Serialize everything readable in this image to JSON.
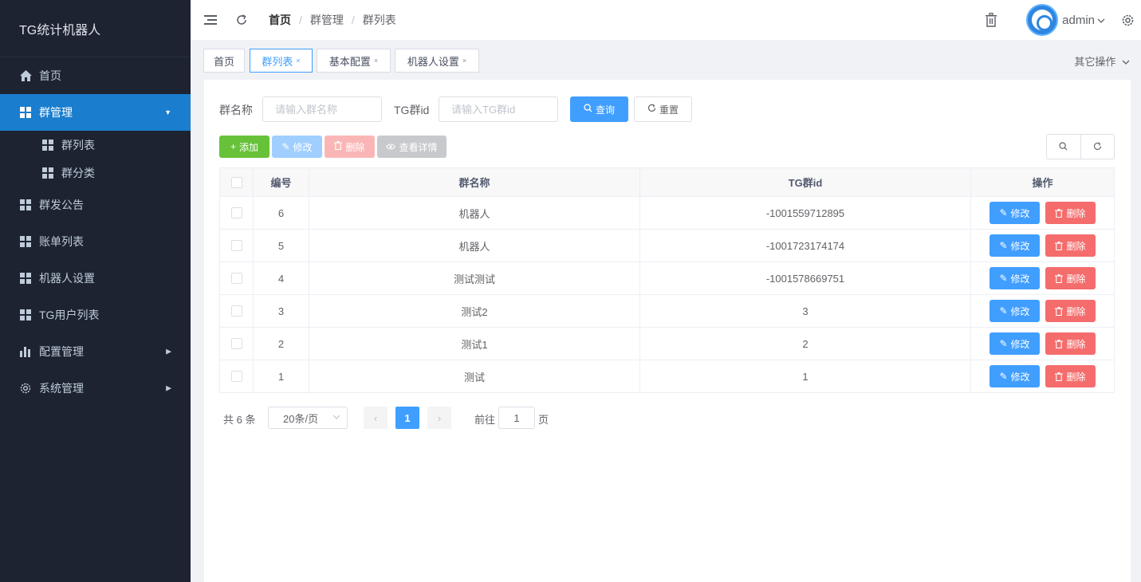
{
  "app": {
    "title": "TG统计机器人"
  },
  "sidebar": {
    "items": [
      {
        "label": "首页",
        "icon": "home-icon"
      },
      {
        "label": "群管理",
        "icon": "grid-icon",
        "active": true,
        "children": [
          {
            "label": "群列表"
          },
          {
            "label": "群分类"
          }
        ]
      },
      {
        "label": "群发公告",
        "icon": "grid-icon"
      },
      {
        "label": "账单列表",
        "icon": "grid-icon"
      },
      {
        "label": "机器人设置",
        "icon": "grid-icon"
      },
      {
        "label": "TG用户列表",
        "icon": "grid-icon"
      },
      {
        "label": "配置管理",
        "icon": "chart-icon"
      },
      {
        "label": "系统管理",
        "icon": "gear-icon"
      }
    ]
  },
  "header": {
    "breadcrumb": [
      "首页",
      "群管理",
      "群列表"
    ],
    "username": "admin"
  },
  "tabs": [
    {
      "label": "首页",
      "closable": false
    },
    {
      "label": "群列表",
      "closable": true,
      "active": true
    },
    {
      "label": "基本配置",
      "closable": true
    },
    {
      "label": "机器人设置",
      "closable": true
    }
  ],
  "tab_close": "×",
  "other_ops": "其它操作",
  "search": {
    "name_label": "群名称",
    "name_placeholder": "请输入群名称",
    "id_label": "TG群id",
    "id_placeholder": "请输入TG群id",
    "query_btn": "查询",
    "reset_btn": "重置"
  },
  "toolbar": {
    "add": "添加",
    "edit": "修改",
    "delete": "删除",
    "detail": "查看详情"
  },
  "table": {
    "columns": [
      "编号",
      "群名称",
      "TG群id",
      "操作"
    ],
    "rows": [
      {
        "id": "6",
        "name": "机器人",
        "tgid": "-1001559712895"
      },
      {
        "id": "5",
        "name": "机器人",
        "tgid": "-1001723174174"
      },
      {
        "id": "4",
        "name": "测试测试",
        "tgid": "-1001578669751"
      },
      {
        "id": "3",
        "name": "测试2",
        "tgid": "3"
      },
      {
        "id": "2",
        "name": "测试1",
        "tgid": "2"
      },
      {
        "id": "1",
        "name": "测试",
        "tgid": "1"
      }
    ],
    "edit_label": "修改",
    "delete_label": "删除"
  },
  "pagination": {
    "total": "共 6 条",
    "page_size": "20条/页",
    "current": "1",
    "goto_prefix": "前往",
    "goto_value": "1",
    "goto_suffix": "页"
  },
  "colors": {
    "primary": "#409eff",
    "sidebar_bg": "#1d2331",
    "active_menu": "#1a7dce",
    "success": "#67c23a",
    "danger": "#f56c6c"
  }
}
